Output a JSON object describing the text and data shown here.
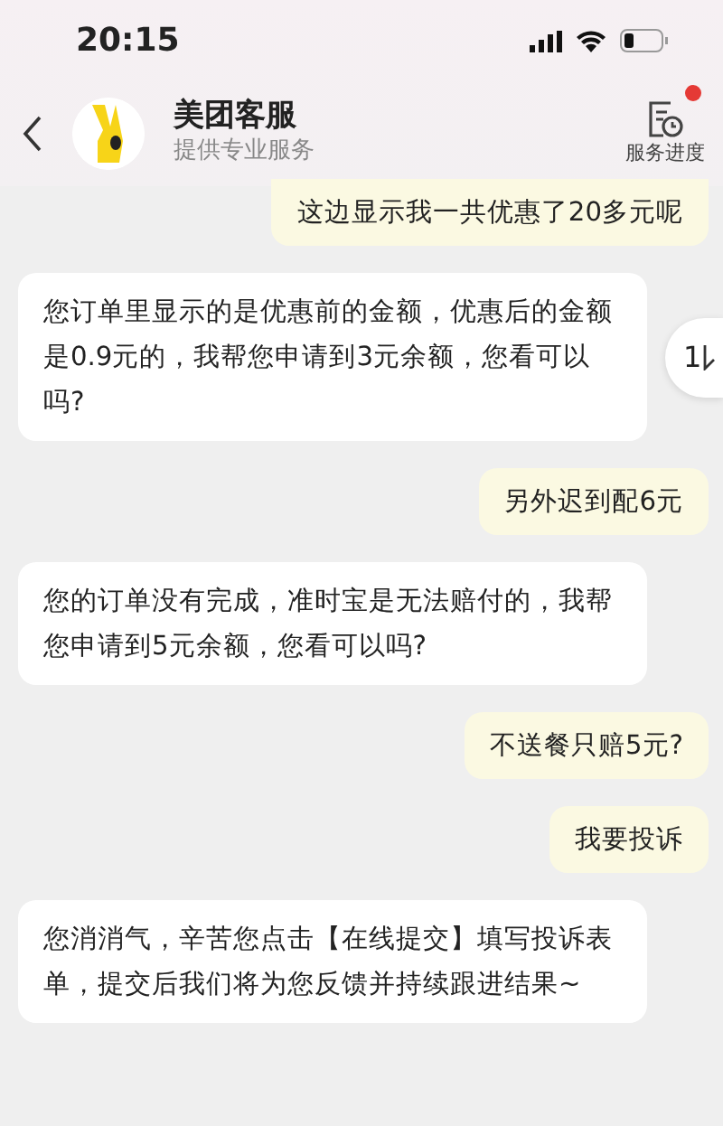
{
  "status_bar": {
    "time": "20:15"
  },
  "header": {
    "title": "美团客服",
    "subtitle": "提供专业服务",
    "action": {
      "label": "服务进度",
      "notification": true
    }
  },
  "messages": [
    {
      "kind": "user",
      "text": "这边显示我一共优惠了20多元呢"
    },
    {
      "kind": "agent",
      "text": "您订单里显示的是优惠前的金额，优惠后的金额是0.9元的，我帮您申请到3元余额，您看可以吗?"
    },
    {
      "kind": "user",
      "text": "另外迟到配6元"
    },
    {
      "kind": "agent",
      "text": "您的订单没有完成，准时宝是无法赔付的，我帮您申请到5元余额，您看可以吗?"
    },
    {
      "kind": "user",
      "text": "不送餐只赔5元?"
    },
    {
      "kind": "user",
      "text": "我要投诉"
    },
    {
      "kind": "agent",
      "text": "您消消气，辛苦您点击【在线提交】填写投诉表单，提交后我们将为您反馈并持续跟进结果~"
    }
  ],
  "scroll_button": {
    "count": "1"
  }
}
